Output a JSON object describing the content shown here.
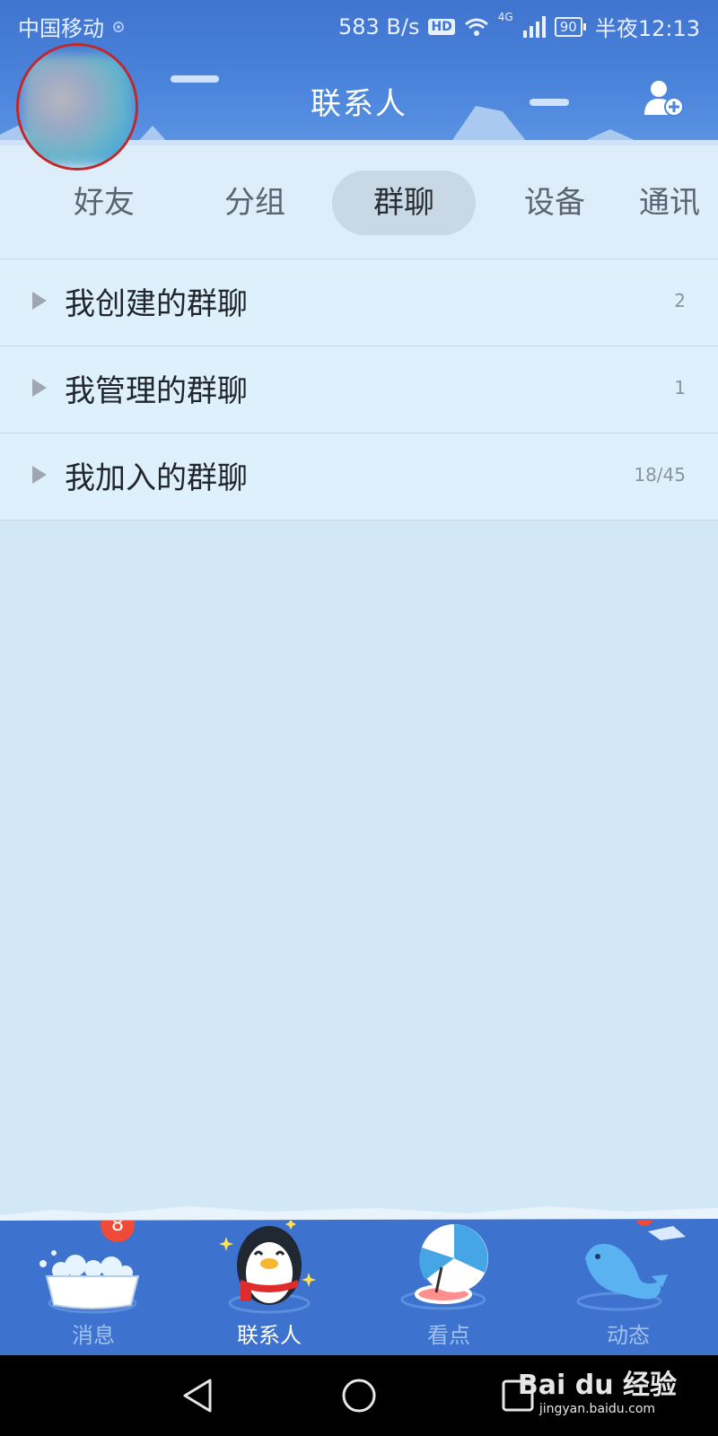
{
  "status_bar": {
    "carrier": "中国移动",
    "speed": "583 B/s",
    "hd": "HD",
    "network": "4G",
    "battery": "90",
    "time": "半夜12:13"
  },
  "header": {
    "title": "联系人"
  },
  "tabs": [
    {
      "label": "好友",
      "active": false
    },
    {
      "label": "分组",
      "active": false
    },
    {
      "label": "群聊",
      "active": true
    },
    {
      "label": "设备",
      "active": false
    },
    {
      "label": "通讯",
      "active": false
    }
  ],
  "groups": [
    {
      "label": "我创建的群聊",
      "count": "2"
    },
    {
      "label": "我管理的群聊",
      "count": "1"
    },
    {
      "label": "我加入的群聊",
      "count": "18/45"
    }
  ],
  "bottom_nav": [
    {
      "label": "消息",
      "badge": "8",
      "icon": "bathtub-icon",
      "active": false
    },
    {
      "label": "联系人",
      "icon": "penguin-icon",
      "active": true
    },
    {
      "label": "看点",
      "icon": "umbrella-icon",
      "active": false
    },
    {
      "label": "动态",
      "icon": "seal-icon",
      "active": false
    }
  ],
  "watermark": {
    "brand": "Bai du 经验",
    "url": "jingyan.baidu.com"
  },
  "colors": {
    "header_blue": "#3f74cf",
    "nav_blue": "#3d72cf",
    "badge_red": "#f04a38",
    "avatar_highlight": "#c0282b",
    "page_bg": "#d3e8f6"
  }
}
